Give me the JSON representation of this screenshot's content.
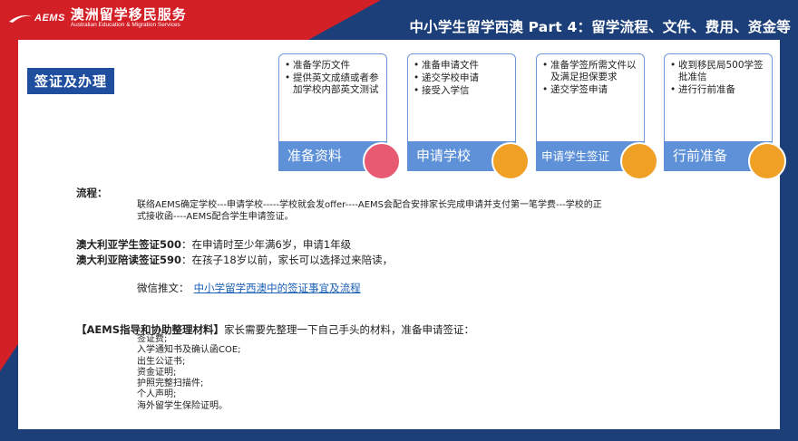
{
  "colors": {
    "frame_blue": "#1c3f7a",
    "frame_red": "#d31f26",
    "tag_blue": "#1f4e9e",
    "bar_blue": "#5e91d8",
    "dot_pink": "#e85a72",
    "dot_orange": "#f0a025",
    "link_blue": "#1a5fb4"
  },
  "header": {
    "logo_mark": "AEMS",
    "logo_cn": "澳洲留学移民服务",
    "logo_en": "Australian Education & Migration Services",
    "title": "中小学生留学西澳 Part 4：留学流程、文件、费用、资金等"
  },
  "section": {
    "tag": "签证及办理"
  },
  "steps": [
    {
      "items": [
        "准备学历文件",
        "提供英文成绩或者参加学校内部英文测试"
      ],
      "label": "准备资料",
      "dot_color": "#e85a72"
    },
    {
      "items": [
        "准备申请文件",
        "递交学校申请",
        "接受入学信"
      ],
      "label": "申请学校",
      "dot_color": "#f0a025"
    },
    {
      "items": [
        "准备学签所需文件以及满足担保要求",
        "递交学签申请"
      ],
      "label": "申请学生签证",
      "dot_color": "#f0a025"
    },
    {
      "items": [
        "收到移民局500学签批准信",
        "进行行前准备"
      ],
      "label": "行前准备",
      "dot_color": "#f0a025"
    }
  ],
  "process": {
    "label": "流程：",
    "line1": "联络AEMS确定学校---申请学校-----学校就会发offer----AEMS会配合安排家长完成申请并支付第一笔学费---学校的正",
    "line2": "式接收函----AEMS配合学生申请签证。"
  },
  "visa": {
    "v500_label": "澳大利亚学生签证500",
    "v500_text": "：在申请时至少年满6岁，申请1年级",
    "v590_label": "澳大利亚陪读签证590",
    "v590_text": "：在孩子18岁以前，家长可以选择过来陪读，"
  },
  "wechat": {
    "label": "微信推文：",
    "link": "中小学留学西澳中的签证事宜及流程"
  },
  "materials": {
    "label": "【AEMS指导和协助整理材料】",
    "intro": "家长需要先整理一下自己手头的材料，准备申请签证：",
    "items": [
      "签证费;",
      "入学通知书及确认函COE;",
      "出生公证书;",
      "资金证明;",
      "护照完整扫描件;",
      "个人声明;",
      "海外留学生保险证明。"
    ]
  }
}
